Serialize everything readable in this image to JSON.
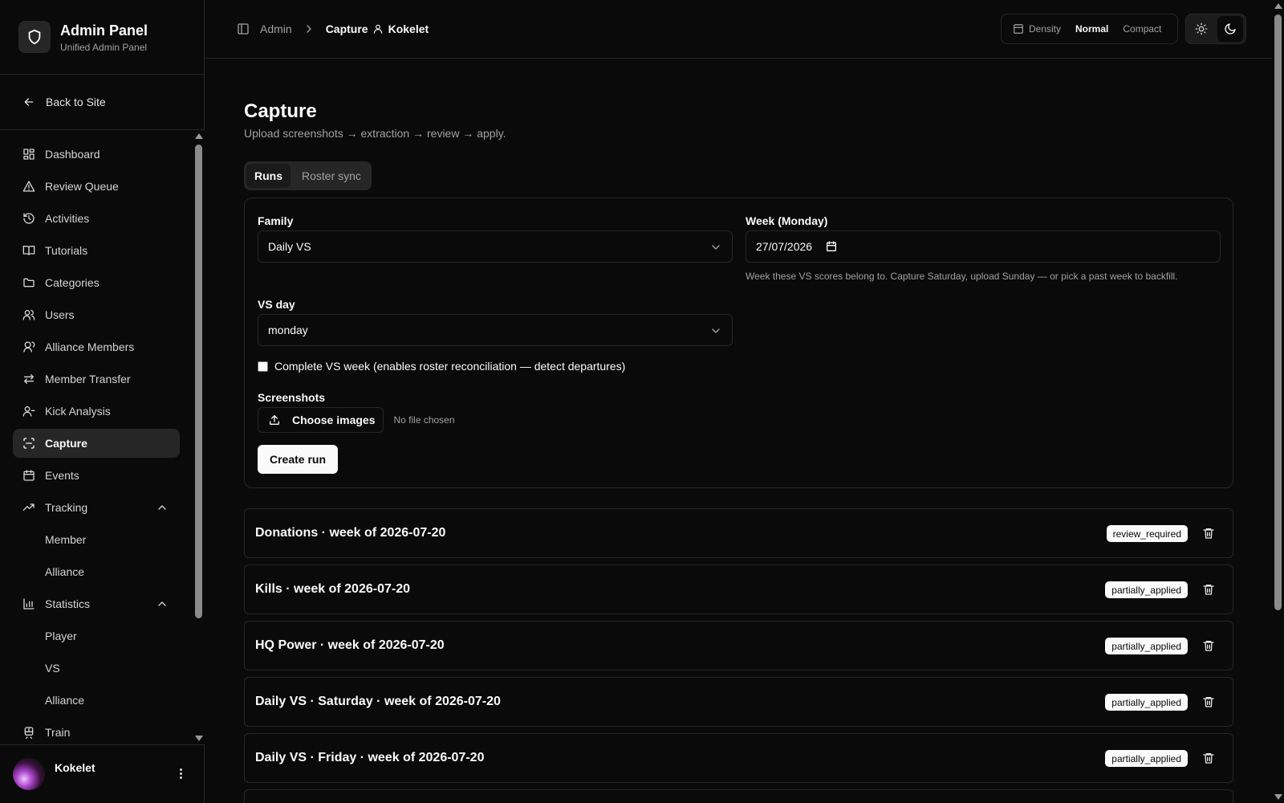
{
  "brand": {
    "title": "Admin Panel",
    "subtitle": "Unified Admin Panel"
  },
  "back": {
    "label": "Back to Site"
  },
  "nav": {
    "items": [
      {
        "label": "Dashboard",
        "icon": "dashboard-icon"
      },
      {
        "label": "Review Queue",
        "icon": "warning-triangle-icon"
      },
      {
        "label": "Activities",
        "icon": "history-icon"
      },
      {
        "label": "Tutorials",
        "icon": "book-icon"
      },
      {
        "label": "Categories",
        "icon": "folder-icon"
      },
      {
        "label": "Users",
        "icon": "users-icon"
      },
      {
        "label": "Alliance Members",
        "icon": "user-group-icon"
      },
      {
        "label": "Member Transfer",
        "icon": "transfer-icon"
      },
      {
        "label": "Kick Analysis",
        "icon": "user-remove-icon"
      },
      {
        "label": "Capture",
        "icon": "scan-icon",
        "active": true
      },
      {
        "label": "Events",
        "icon": "calendar-icon"
      },
      {
        "label": "Tracking",
        "icon": "trending-up-icon"
      },
      {
        "label": "Statistics",
        "icon": "bar-chart-icon"
      },
      {
        "label": "Train",
        "icon": "train-icon"
      }
    ],
    "tracking_sub": [
      "Member",
      "Alliance"
    ],
    "statistics_sub": [
      "Player",
      "VS",
      "Alliance"
    ]
  },
  "user": {
    "name": "Kokelet"
  },
  "header": {
    "crumb_admin": "Admin",
    "crumb_capture": "Capture",
    "crumb_user": "Kokelet",
    "density_label": "Density",
    "density_normal": "Normal",
    "density_compact": "Compact"
  },
  "page": {
    "title": "Capture",
    "subtitle": "Upload screenshots → extraction → review → apply.",
    "tabs": [
      "Runs",
      "Roster sync"
    ]
  },
  "form": {
    "family_label": "Family",
    "family_value": "Daily VS",
    "week_label": "Week (Monday)",
    "week_value": "27/07/2026",
    "week_help": "Week these VS scores belong to. Capture Saturday, upload Sunday — or pick a past week to backfill.",
    "vsday_label": "VS day",
    "vsday_value": "monday",
    "complete_label": "Complete VS week (enables roster reconciliation — detect departures)",
    "screenshots_label": "Screenshots",
    "choose_label": "Choose images",
    "file_status": "No file chosen",
    "create_label": "Create run"
  },
  "runs": [
    {
      "title": "Donations · week of 2026-07-20",
      "status": "review_required"
    },
    {
      "title": "Kills · week of 2026-07-20",
      "status": "partially_applied"
    },
    {
      "title": "HQ Power · week of 2026-07-20",
      "status": "partially_applied"
    },
    {
      "title": "Daily VS · Saturday · week of 2026-07-20",
      "status": "partially_applied"
    },
    {
      "title": "Daily VS · Friday · week of 2026-07-20",
      "status": "partially_applied"
    }
  ]
}
